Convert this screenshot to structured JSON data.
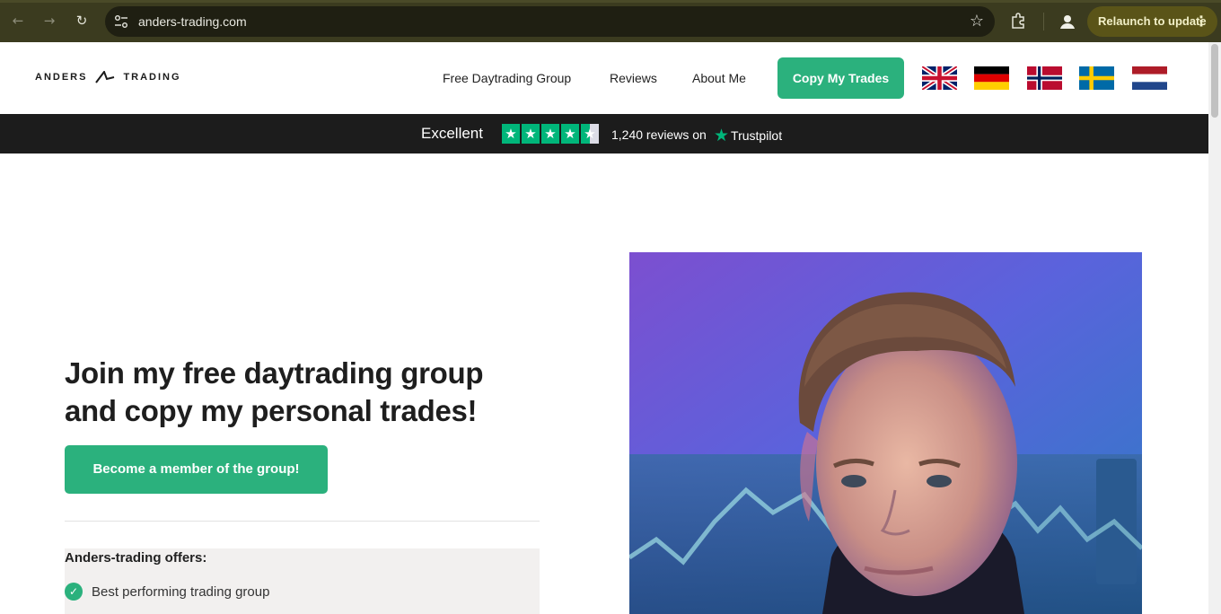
{
  "browser": {
    "url": "anders-trading.com",
    "relaunch_label": "Relaunch to update",
    "icons": [
      "back-icon",
      "forward-icon",
      "reload-icon",
      "site-settings-icon",
      "bookmark-star-icon",
      "extensions-icon",
      "profile-icon",
      "more-menu-icon"
    ]
  },
  "header": {
    "logo_left": "ANDERS",
    "logo_right": "TRADING",
    "menu": [
      {
        "label": "Free Daytrading Group"
      },
      {
        "label": "Reviews"
      },
      {
        "label": "About Me"
      }
    ],
    "cta_label": "Copy My Trades",
    "flags": [
      "uk-flag",
      "germany-flag",
      "norway-flag",
      "sweden-flag",
      "netherlands-flag"
    ]
  },
  "trustpilot": {
    "rating_word": "Excellent",
    "stars": 4.5,
    "reviews_text": "1,240 reviews on",
    "brand": "Trustpilot"
  },
  "hero": {
    "title_line1": "Join my free daytrading group",
    "title_line2": "and copy my personal trades!",
    "cta_label": "Become a member of the group!",
    "offers_title": "Anders-trading offers:",
    "offers": [
      {
        "label": "Best performing trading group"
      }
    ]
  },
  "colors": {
    "accent": "#2bb17d",
    "trustpilot_green": "#00b67a",
    "trustpilot_bar": "#1c1c1c",
    "chrome_bar": "#3b3b1f"
  }
}
